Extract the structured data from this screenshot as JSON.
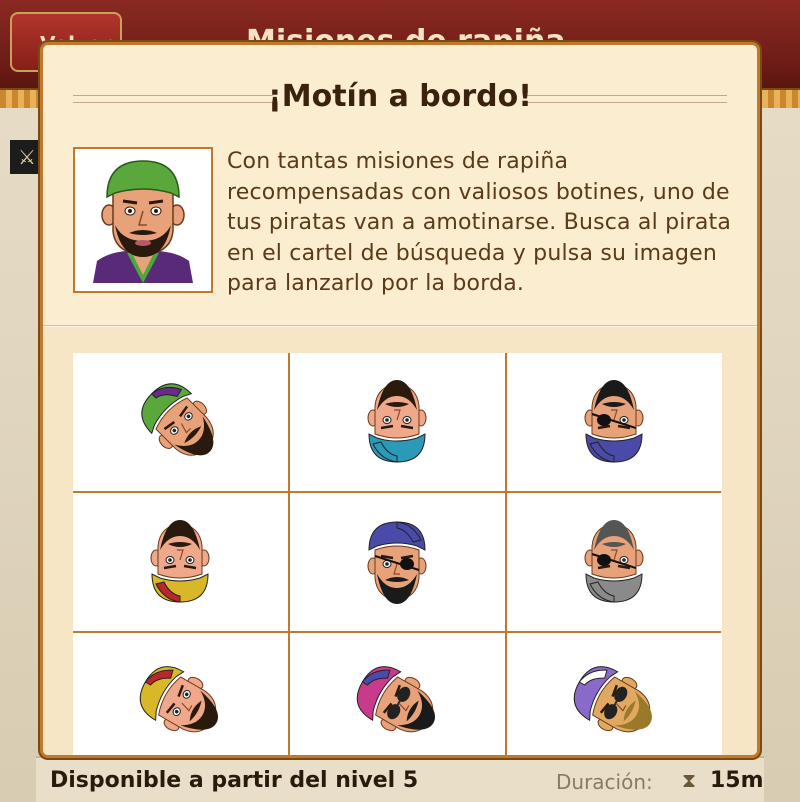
{
  "background": {
    "back_label": "Volver",
    "screen_title": "Misiones de rapiña",
    "footer_text": "Disponible a partir del nivel 5",
    "duration_label": "Duración:",
    "duration_value": "15m"
  },
  "modal": {
    "title": "¡Motín a bordo!",
    "description": "Con tantas misiones de rapiña recompensadas con valiosos botines, uno de tus piratas van a amotinarse. Busca al pirata en el cartel de búsqueda y pulsa su imagen para lanzarlo por la borda.",
    "portrait": {
      "hat": "#5aa83c",
      "skin": "#e8a27a",
      "beard": "#2a1a0e",
      "shirt": "#5a2a7a",
      "collar": "#4aa83c"
    },
    "grid": [
      {
        "name": "pirata-1",
        "rotation": -45,
        "hat": "#5aa83c",
        "hat2": "#6a2a8a",
        "skin": "#e8a27a",
        "beard": "#2a1a0e",
        "glasses": false,
        "patch": false
      },
      {
        "name": "pirata-2",
        "rotation": 180,
        "hat": "#2a9ab8",
        "hat2": "#2a9ab8",
        "skin": "#f0a88a",
        "beard": "#2a1a0e",
        "glasses": false,
        "patch": false
      },
      {
        "name": "pirata-3",
        "rotation": 180,
        "hat": "#4a4aa8",
        "hat2": "#4a4aa8",
        "skin": "#e8a27a",
        "beard": "#1a1a1a",
        "glasses": false,
        "patch": true
      },
      {
        "name": "pirata-4",
        "rotation": 180,
        "hat": "#d8b828",
        "hat2": "#b8282a",
        "skin": "#f0a88a",
        "beard": "#2a1a0e",
        "glasses": false,
        "patch": false
      },
      {
        "name": "pirata-5",
        "rotation": 0,
        "hat": "#4a4aa8",
        "hat2": "#4a4aa8",
        "skin": "#e8a27a",
        "beard": "#1a1a1a",
        "glasses": false,
        "patch": true
      },
      {
        "name": "pirata-6",
        "rotation": 180,
        "hat": "#8a8a8a",
        "hat2": "#8a8a8a",
        "skin": "#e8a27a",
        "beard": "#555555",
        "glasses": false,
        "patch": true
      },
      {
        "name": "pirata-7",
        "rotation": -60,
        "hat": "#d8b828",
        "hat2": "#b8282a",
        "skin": "#f0a88a",
        "beard": "#2a1a0e",
        "glasses": false,
        "patch": false
      },
      {
        "name": "pirata-8",
        "rotation": -60,
        "hat": "#c83a8a",
        "hat2": "#4a4aa8",
        "skin": "#e8a27a",
        "beard": "#1a1a1a",
        "glasses": true,
        "patch": false
      },
      {
        "name": "pirata-9",
        "rotation": -60,
        "hat": "#8a6ac8",
        "hat2": "#ffffff",
        "skin": "#e0a860",
        "beard": "#9a7a2a",
        "glasses": true,
        "patch": false
      }
    ]
  }
}
